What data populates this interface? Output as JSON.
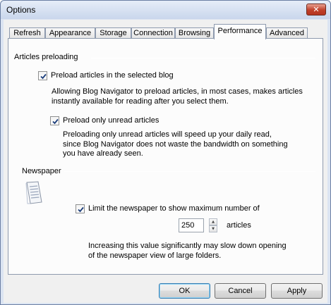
{
  "window": {
    "title": "Options",
    "close_symbol": "✕"
  },
  "tabs": [
    {
      "label": "Refresh",
      "active": false
    },
    {
      "label": "Appearance",
      "active": false
    },
    {
      "label": "Storage",
      "active": false
    },
    {
      "label": "Connection",
      "active": false
    },
    {
      "label": "Browsing",
      "active": false
    },
    {
      "label": "Performance",
      "active": true
    },
    {
      "label": "Advanced",
      "active": false
    }
  ],
  "preloading": {
    "group_title": "Articles preloading",
    "preload_selected": {
      "label": "Preload articles in the selected blog",
      "checked": true,
      "description": "Allowing Blog Navigator to preload articles, in most cases, makes articles instantly available for reading after you select them."
    },
    "preload_unread": {
      "label": "Preload only unread articles",
      "checked": true,
      "description": "Preloading only unread articles will speed up your daily read, since Blog Navigator does not waste the bandwidth on something you have already seen."
    }
  },
  "newspaper": {
    "group_title": "Newspaper",
    "icon": "newspaper-icon",
    "limit": {
      "label": "Limit the newspaper to show maximum number of",
      "checked": true,
      "value": "250",
      "unit": "articles"
    },
    "note": "Increasing this value significantly may slow down opening of the newspaper view of large folders."
  },
  "buttons": {
    "ok": "OK",
    "cancel": "Cancel",
    "apply": "Apply"
  }
}
